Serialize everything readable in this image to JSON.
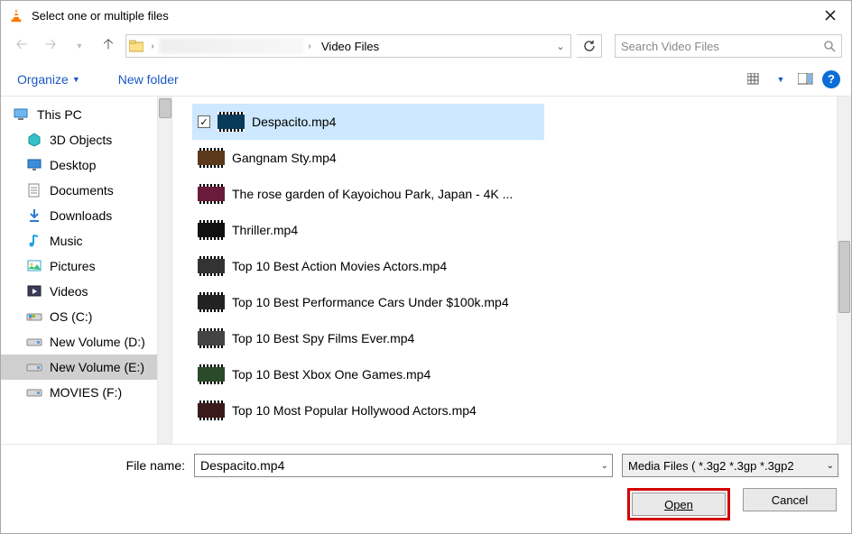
{
  "window": {
    "title": "Select one or multiple files"
  },
  "addressbar": {
    "crumb": "Video Files"
  },
  "search": {
    "placeholder": "Search Video Files"
  },
  "toolbar": {
    "organize": "Organize",
    "new_folder": "New folder"
  },
  "sidebar": {
    "root": "This PC",
    "items": [
      {
        "label": "3D Objects"
      },
      {
        "label": "Desktop"
      },
      {
        "label": "Documents"
      },
      {
        "label": "Downloads"
      },
      {
        "label": "Music"
      },
      {
        "label": "Pictures"
      },
      {
        "label": "Videos"
      },
      {
        "label": "OS (C:)"
      },
      {
        "label": "New Volume (D:)"
      },
      {
        "label": "New Volume (E:)"
      },
      {
        "label": "MOVIES (F:)"
      }
    ]
  },
  "files": [
    {
      "name": "Despacito.mp4",
      "selected": true
    },
    {
      "name": "Gangnam Sty.mp4"
    },
    {
      "name": "The rose garden of Kayoichou Park, Japan - 4K ..."
    },
    {
      "name": "Thriller.mp4"
    },
    {
      "name": "Top 10 Best Action Movies Actors.mp4"
    },
    {
      "name": "Top 10 Best Performance Cars Under $100k.mp4"
    },
    {
      "name": "Top 10 Best Spy Films Ever.mp4"
    },
    {
      "name": "Top 10 Best Xbox One Games.mp4"
    },
    {
      "name": "Top 10 Most Popular Hollywood Actors.mp4"
    }
  ],
  "footer": {
    "filename_label": "File name:",
    "filename_value": "Despacito.mp4",
    "filter": "Media Files ( *.3g2 *.3gp *.3gp2",
    "open": "Open",
    "cancel": "Cancel"
  }
}
